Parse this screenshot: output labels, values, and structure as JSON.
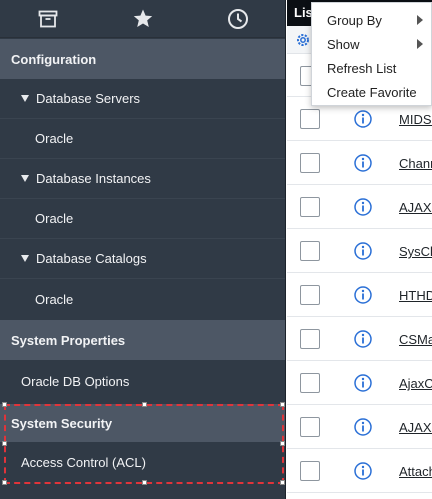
{
  "nav": {
    "tabs": [
      {
        "icon": "archive-icon"
      },
      {
        "icon": "star-icon"
      },
      {
        "icon": "clock-icon"
      }
    ],
    "items": [
      {
        "label": "Configuration"
      },
      {
        "label": "Database Servers"
      },
      {
        "label": "Oracle"
      },
      {
        "label": "Database Instances"
      },
      {
        "label": "Oracle"
      },
      {
        "label": "Database Catalogs"
      },
      {
        "label": "Oracle"
      },
      {
        "label": "System Properties"
      },
      {
        "label": "Oracle DB Options"
      },
      {
        "label": "System Security"
      },
      {
        "label": "Access Control (ACL)"
      }
    ]
  },
  "list": {
    "title": "Lis",
    "rows": [
      {
        "link": "MIDSe"
      },
      {
        "link": "Chann"
      },
      {
        "link": "AJAXC"
      },
      {
        "link": "SysClu"
      },
      {
        "link": "HTHD."
      },
      {
        "link": "CSMan"
      },
      {
        "link": "AjaxCu"
      },
      {
        "link": "AJAXP"
      },
      {
        "link": "Attach"
      }
    ]
  },
  "menu": {
    "items": [
      {
        "label": "Group By"
      },
      {
        "label": "Show"
      },
      {
        "label": "Refresh List"
      },
      {
        "label": "Create Favorite"
      }
    ]
  },
  "colors": {
    "nav_bg": "#303a46",
    "section_bg": "#4d5765",
    "highlight": "#e0343a",
    "info_icon": "#2a6fd6"
  }
}
